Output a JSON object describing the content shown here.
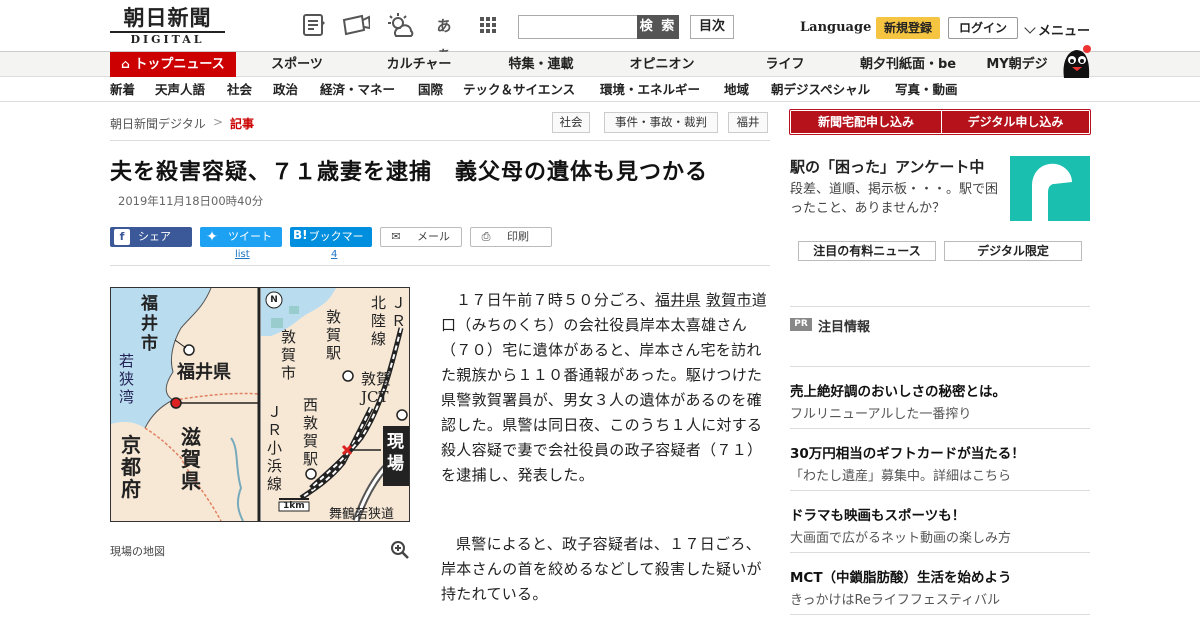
{
  "header": {
    "logo_jp": "朝日新聞",
    "logo_en": "DIGITAL",
    "icon_kana": "あぁ",
    "search_button": "検 索",
    "toc_button": "目次",
    "language": "Language",
    "register": "新規登録",
    "login": "ログイン",
    "menu": "メニュー"
  },
  "gnav": {
    "top": "トップニュース",
    "items": [
      "スポーツ",
      "カルチャー",
      "特集・連載",
      "オピニオン",
      "ライフ",
      "朝夕刊紙面・be",
      "MY朝デジ"
    ]
  },
  "subnav": {
    "items": [
      "新着",
      "天声人語",
      "社会",
      "政治",
      "経済・マネー",
      "国際",
      "テック＆サイエンス",
      "環境・エネルギー",
      "地域",
      "朝デジスペシャル",
      "写真・動画"
    ]
  },
  "breadcrumb": {
    "home": "朝日新聞デジタル",
    "sep": ">",
    "current": "記事",
    "tags": [
      "社会",
      "事件・事故・裁判",
      "福井"
    ]
  },
  "article": {
    "headline": "夫を殺害容疑、７１歳妻を逮捕　義父母の遺体も見つかる",
    "date": "2019年11月18日00時40分",
    "share": {
      "facebook": "シェア",
      "twitter": "ツイート",
      "twitter_count": "list",
      "hatena": "ブックマーク",
      "hatena_count": "4",
      "mail": "メール",
      "print": "印刷"
    },
    "map_caption": "現場の地図",
    "map_labels": {
      "fukui_city": "福井市",
      "fukui_pref": "福井県",
      "wakasa_bay": "若狭湾",
      "kyoto": "京都府",
      "shiga": "滋賀県",
      "tsuruga_city": "敦賀市",
      "tsuruga_sta": "敦賀駅",
      "hokuriku": "北陸線",
      "jr1": "ＪＲ",
      "tsuruga_jct": "敦賀JCT",
      "nishi_tsuruga": "西敦賀駅",
      "obama": "ＪＲ小浜線",
      "site": "現場",
      "maizuru": "舞鶴若狭道",
      "scale": "1km",
      "north": "N"
    },
    "para1_pre": "１７日午前７時５０分ごろ、",
    "para1_link1": "福井県",
    "para1_space": "",
    "para1_link2": "敦賀市",
    "para1_post": "道口（みちのくち）の会社役員岸本太喜雄さん（７０）宅に遺体があると、岸本さん宅を訪れた親族から１１０番通報があった。駆けつけた県警敦賀署員が、男女３人の遺体があるのを確認した。県警は同日夜、このうち１人に対する殺人容疑で妻で会社役員の政子容疑者（７１）を逮捕し、発表した。",
    "para2": "県警によると、政子容疑者は、１７日ごろ、岸本さんの首を絞めるなどして殺害した疑いが持たれている。"
  },
  "sidebar": {
    "subscribe_paper": "新聞宅配申し込み",
    "subscribe_digital": "デジタル申し込み",
    "survey_title": "駅の「困った」アンケート中",
    "survey_text": "段差、道順、掲示板・・・。駅で困ったこと、ありませんか？",
    "paid_news": "注目の有料ニュース",
    "digital_only": "デジタル限定",
    "pr_badge": "PR",
    "pr_title": "注目情報",
    "ads": [
      {
        "title": "売上絶好調のおいしさの秘密とは。",
        "desc": "フルリニューアルした一番搾り"
      },
      {
        "title": "30万円相当のギフトカードが当たる！",
        "desc": "「わたし遺産」募集中。詳細はこちら"
      },
      {
        "title": "ドラマも映画もスポーツも！",
        "desc": "大画面で広がるネット動画の楽しみ方"
      },
      {
        "title": "MCT（中鎖脂肪酸）生活を始めよう",
        "desc": "きっかけはReライフフェスティバル"
      }
    ]
  },
  "colors": {
    "brand_red": "#c00",
    "subscribe_red": "#b5121b",
    "register_yellow": "#f5c542",
    "teal": "#1bbfb0",
    "facebook": "#3b5998",
    "twitter": "#1da1f2",
    "hatena": "#008fde"
  }
}
